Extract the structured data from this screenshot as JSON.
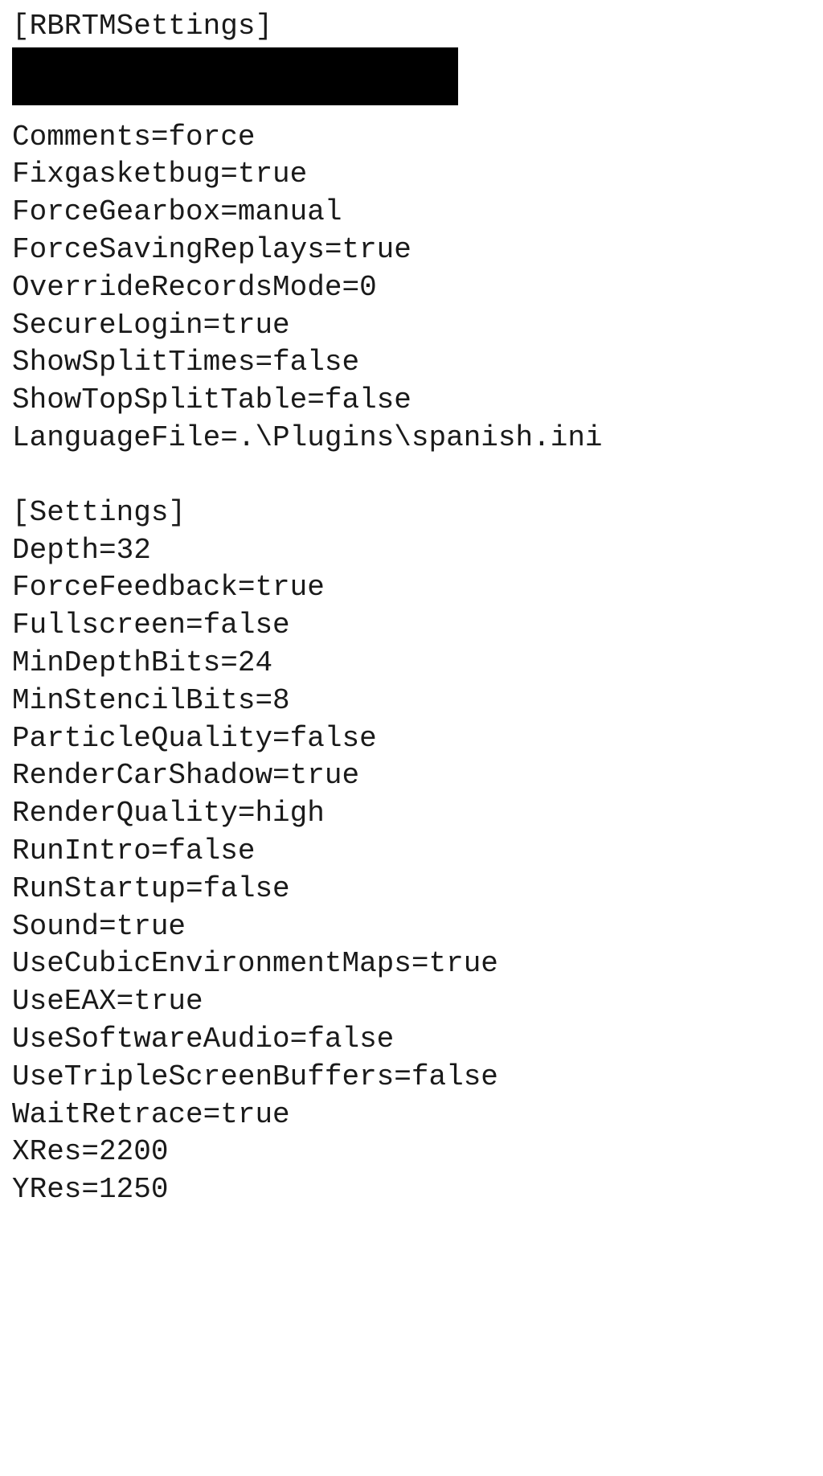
{
  "sections": {
    "rbrtm": {
      "header": "[RBRTMSettings]",
      "entries": [
        "Comments=force",
        "Fixgasketbug=true",
        "ForceGearbox=manual",
        "ForceSavingReplays=true",
        "OverrideRecordsMode=0",
        "SecureLogin=true",
        "ShowSplitTimes=false",
        "ShowTopSplitTable=false",
        "LanguageFile=.\\Plugins\\spanish.ini"
      ]
    },
    "settings": {
      "header": "[Settings]",
      "entries": [
        "Depth=32",
        "ForceFeedback=true",
        "Fullscreen=false",
        "MinDepthBits=24",
        "MinStencilBits=8",
        "ParticleQuality=false",
        "RenderCarShadow=true",
        "RenderQuality=high",
        "RunIntro=false",
        "RunStartup=false",
        "Sound=true",
        "UseCubicEnvironmentMaps=true",
        "UseEAX=true",
        "UseSoftwareAudio=false",
        "UseTripleScreenBuffers=false",
        "WaitRetrace=true",
        "XRes=2200",
        "YRes=1250"
      ]
    }
  }
}
